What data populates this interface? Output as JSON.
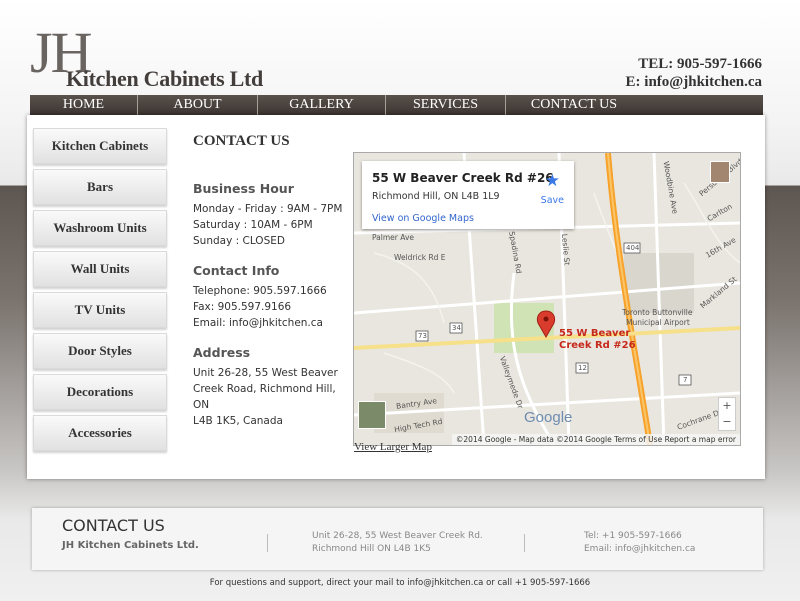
{
  "header": {
    "logo_letters": "JH",
    "logo_name": "Kitchen Cabinets Ltd",
    "tel": "TEL: 905-597-1666",
    "email": "E: info@jhkitchen.ca"
  },
  "nav": [
    "HOME",
    "ABOUT",
    "GALLERY",
    "SERVICES",
    "CONTACT US"
  ],
  "sidebar": [
    "Kitchen Cabinets",
    "Bars",
    "Washroom Units",
    "Wall Units",
    "TV Units",
    "Door Styles",
    "Decorations",
    "Accessories"
  ],
  "content": {
    "title": "CONTACT US",
    "hours_heading": "Business Hour",
    "hours": [
      "Monday - Friday : 9AM - 7PM",
      "Saturday : 10AM - 6PM",
      "Sunday : CLOSED"
    ],
    "contact_heading": "Contact Info",
    "contact": [
      "Telephone: 905.597.1666",
      "Fax: 905.597.9166",
      "Email: info@jhkitchen.ca"
    ],
    "address_heading": "Address",
    "address": [
      "Unit 26-28, 55 West Beaver",
      "Creek Road, Richmond Hill, ON",
      "L4B 1K5, Canada"
    ],
    "larger_map": "View Larger Map"
  },
  "map": {
    "popup_title": "55 W Beaver Creek Rd #26",
    "popup_address": "Richmond Hill, ON L4B 1L9",
    "popup_link": "View on Google Maps",
    "save": "Save",
    "pin_label_1": "55 W Beaver",
    "pin_label_2": "Creek Rd #26",
    "google": "Google",
    "attribution": "©2014 Google - Map data ©2014 Google    Terms of Use    Report a map error",
    "zoom_in": "+",
    "zoom_out": "−",
    "labels": [
      "Palmer Ave",
      "Weldrick Rd E",
      "Spadina Rd",
      "Leslie St",
      "Woodbine Ave",
      "Bantry Ave",
      "High Tech Rd",
      "Valleymede Dr",
      "Toronto Buttonville",
      "Municipal Airport",
      "Cochrane Dr",
      "16th Ave",
      "Markland St",
      "Carlton",
      "Personna Blvd",
      "404",
      "7",
      "73",
      "34",
      "12"
    ],
    "colors": {
      "highway": "#f7a22b",
      "pin": "#d93c2d",
      "link": "#3366cc"
    }
  },
  "footer": {
    "title": "CONTACT US",
    "name": "JH Kitchen Cabinets Ltd.",
    "address_1": "Unit 26-28, 55 West Beaver Creek Rd.",
    "address_2": "Richmond Hill ON L4B 1K5",
    "tel": "Tel: +1 905-597-1666",
    "email": "Email: info@jhkitchen.ca",
    "bottom": "For questions and support, direct your mail to info@jhkitchen.ca or call +1 905-597-1666"
  }
}
